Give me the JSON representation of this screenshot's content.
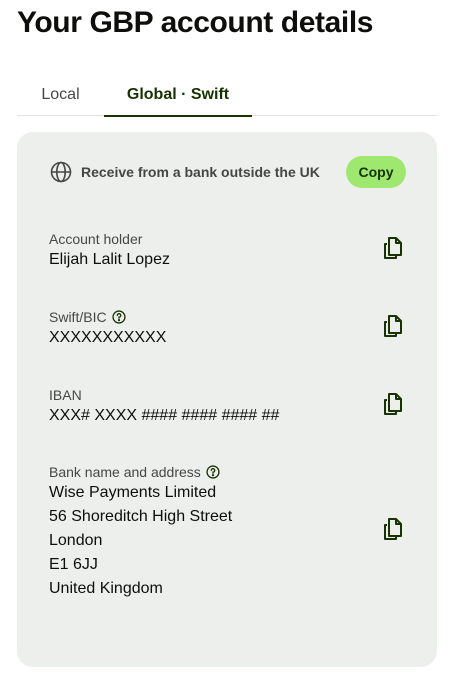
{
  "page": {
    "title": "Your GBP account details"
  },
  "tabs": [
    {
      "label": "Local",
      "active": false
    },
    {
      "label": "Global · Swift",
      "active": true
    }
  ],
  "card": {
    "receive_text": "Receive from a bank outside the UK",
    "copy_button_label": "Copy",
    "fields": {
      "account_holder": {
        "label": "Account holder",
        "value": "Elijah Lalit Lopez"
      },
      "swift_bic": {
        "label": "Swift/BIC",
        "value": "XXXXXXXXXXX"
      },
      "iban": {
        "label": "IBAN",
        "value": "XXX# XXXX #### #### #### ##"
      },
      "bank_address": {
        "label": "Bank name and address",
        "lines": [
          "Wise Payments Limited",
          "56 Shoreditch High Street",
          "London",
          "E1 6JJ",
          "United Kingdom"
        ]
      }
    }
  },
  "icons": {
    "globe": "globe-icon",
    "copy": "copy-icon",
    "help": "help-circle-icon"
  },
  "colors": {
    "text_primary": "#0e0f0c",
    "text_secondary": "#454745",
    "brand_dark_green": "#163300",
    "brand_bright_green": "#9fe870",
    "card_background": "#edefec"
  }
}
